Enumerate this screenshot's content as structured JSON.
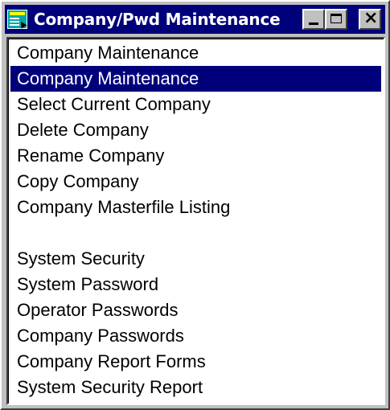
{
  "window": {
    "title": "Company/Pwd Maintenance",
    "controls": {
      "minimize": "minimize",
      "maximize": "maximize",
      "close": "close"
    }
  },
  "menu": {
    "items": [
      {
        "label": "Company Maintenance",
        "selected": false
      },
      {
        "label": "Company Maintenance",
        "selected": true
      },
      {
        "label": "Select Current Company",
        "selected": false
      },
      {
        "label": "Delete Company",
        "selected": false
      },
      {
        "label": "Rename Company",
        "selected": false
      },
      {
        "label": "Copy Company",
        "selected": false
      },
      {
        "label": "Company Masterfile Listing",
        "selected": false
      },
      {
        "label": "",
        "selected": false
      },
      {
        "label": "System Security",
        "selected": false
      },
      {
        "label": "System Password",
        "selected": false
      },
      {
        "label": "Operator Passwords",
        "selected": false
      },
      {
        "label": "Company Passwords",
        "selected": false
      },
      {
        "label": "Company Report Forms",
        "selected": false
      },
      {
        "label": "System Security Report",
        "selected": false
      }
    ]
  },
  "colors": {
    "titlebar": "#00007b",
    "selection": "#00007b",
    "face": "#c0c0c0"
  }
}
